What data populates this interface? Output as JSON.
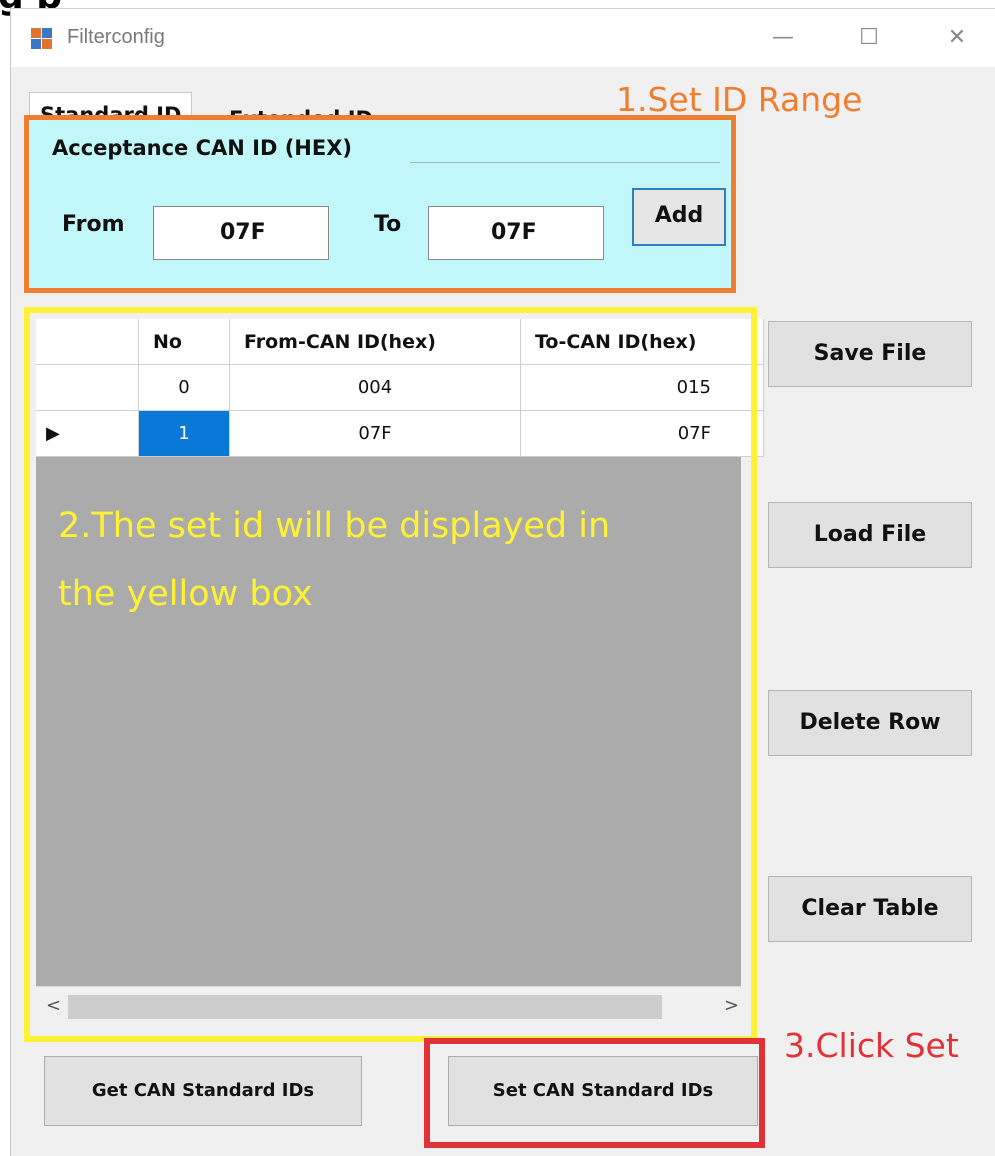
{
  "page_fragment": "g p",
  "window": {
    "title": "Filterconfig",
    "minimize_glyph": "—",
    "maximize_glyph": "☐",
    "close_glyph": "✕",
    "icon": "app-window-icon"
  },
  "tabs": [
    {
      "label": "Standard ID",
      "active": true
    },
    {
      "label": "Extended ID",
      "active": false
    }
  ],
  "acceptance": {
    "group_title": "Acceptance CAN ID (HEX)",
    "from_label": "From",
    "from_value": "07F",
    "to_label": "To",
    "to_value": "07F",
    "add_label": "Add"
  },
  "grid": {
    "columns": [
      "No",
      "From-CAN ID(hex)",
      "To-CAN ID(hex)"
    ],
    "rows": [
      {
        "no": "0",
        "from": "004",
        "to": "015",
        "current": false
      },
      {
        "no": "1",
        "from": "07F",
        "to": "07F",
        "current": true
      }
    ],
    "scroll_left": "<",
    "scroll_right": ">"
  },
  "side_buttons": {
    "save": "Save File",
    "load": "Load File",
    "delete": "Delete Row",
    "clear": "Clear Table"
  },
  "bottom_buttons": {
    "get": "Get CAN Standard IDs",
    "set": "Set CAN Standard IDs"
  },
  "annotations": {
    "step1": "1.Set ID Range",
    "step2_line1": "2.The set id will be displayed in",
    "step2_line2": "the yellow box",
    "step3": "3.Click Set"
  },
  "colors": {
    "orange": "#ef7e31",
    "yellow": "#fff133",
    "red": "#e13238",
    "selection": "#0a78d7",
    "panel": "#c2f7fa"
  }
}
